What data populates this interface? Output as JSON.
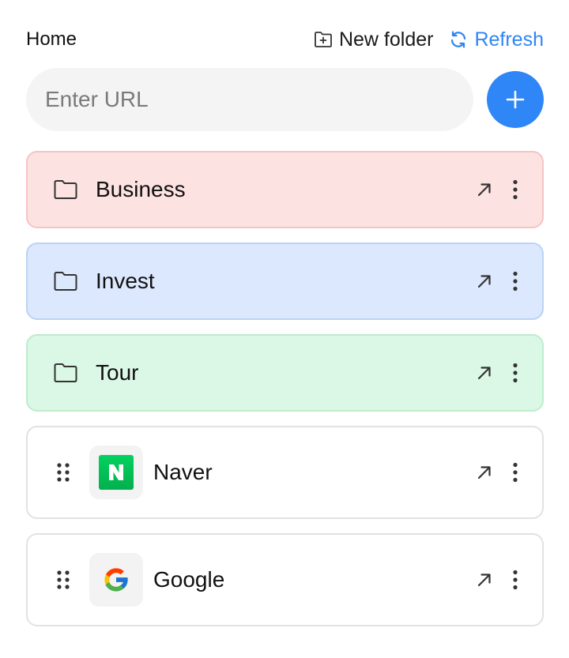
{
  "header": {
    "crumb": "Home",
    "new_folder_label": "New folder",
    "refresh_label": "Refresh"
  },
  "url_bar": {
    "placeholder": "Enter URL",
    "value": ""
  },
  "folders": [
    {
      "label": "Business",
      "bg": "#fde2e2",
      "border": "#f7c4c4",
      "icon": "folder-icon"
    },
    {
      "label": "Invest",
      "bg": "#dce8fd",
      "border": "#bcd3f5",
      "icon": "folder-icon"
    },
    {
      "label": "Tour",
      "bg": "#dbf8e6",
      "border": "#bdeccd",
      "icon": "folder-icon"
    }
  ],
  "links": [
    {
      "label": "Naver",
      "icon": "naver-favicon"
    },
    {
      "label": "Google",
      "icon": "google-favicon"
    }
  ],
  "colors": {
    "accent": "#2f86f6",
    "naver_green": "#03c75a"
  }
}
